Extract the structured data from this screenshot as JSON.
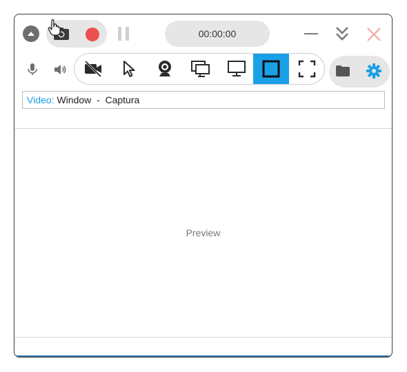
{
  "toolbar": {
    "timer": "00:00:00",
    "icons": [
      "collapse-up-icon",
      "camera-icon",
      "record-icon",
      "pause-icon",
      "minimize-icon",
      "double-chevron-down-icon",
      "close-icon"
    ]
  },
  "modes": {
    "items": [
      "video-off",
      "cursor",
      "webcam",
      "windows",
      "screen",
      "window",
      "fullscreen-region"
    ],
    "active": "window",
    "accent_color": "#1aa0e6",
    "record_color": "#ec4f4f"
  },
  "source": {
    "label": "Video:",
    "value": "Window  -  Captura"
  },
  "preview": {
    "label": "Preview"
  }
}
